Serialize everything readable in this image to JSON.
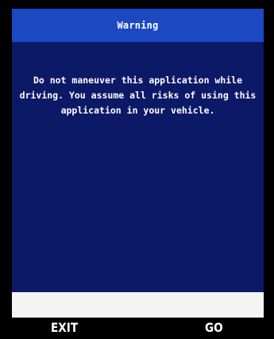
{
  "dialog": {
    "title": "Warning",
    "message": "Do not maneuver this application while driving. You assume all risks of using this application in your vehicle."
  },
  "softkeys": {
    "left_label": "EXIT",
    "right_label": "GO"
  },
  "colors": {
    "background": "#000000",
    "title_bar": "#1c49c2",
    "dialog_body": "#0c1967",
    "input_strip": "#f4f4f2",
    "text": "#ffffff"
  }
}
